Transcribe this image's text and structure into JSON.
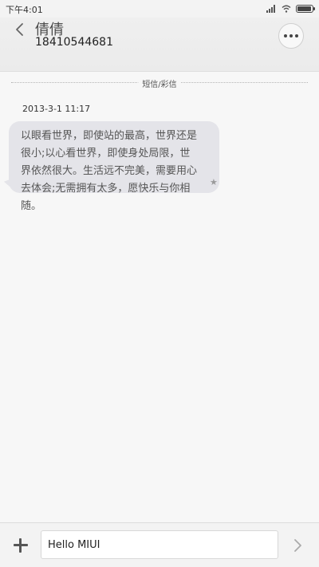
{
  "status_bar": {
    "time": "下午4:01",
    "battery_level": 0.85
  },
  "header": {
    "contact_name": "倩倩",
    "contact_number": "18410544681"
  },
  "conversation": {
    "divider_label": "短信/彩信",
    "messages": [
      {
        "timestamp": "2013-3-1 11:17",
        "text": "以眼看世界，即使站的最高，世界还是很小;以心看世界，即使身处局限，世界依然很大。生活远不完美，需要用心去体会;无需拥有太多，愿快乐与你相随。",
        "mark": "★"
      }
    ]
  },
  "compose": {
    "input_value": "Hello MIUI"
  },
  "colors": {
    "bubble": "#e4e4e9",
    "header": "#ececec",
    "background": "#f7f7f7"
  },
  "icons": [
    "signal-icon",
    "wifi-icon",
    "battery-icon",
    "back-arrow-icon",
    "more-dots-icon",
    "plus-icon",
    "send-arrow-icon"
  ]
}
